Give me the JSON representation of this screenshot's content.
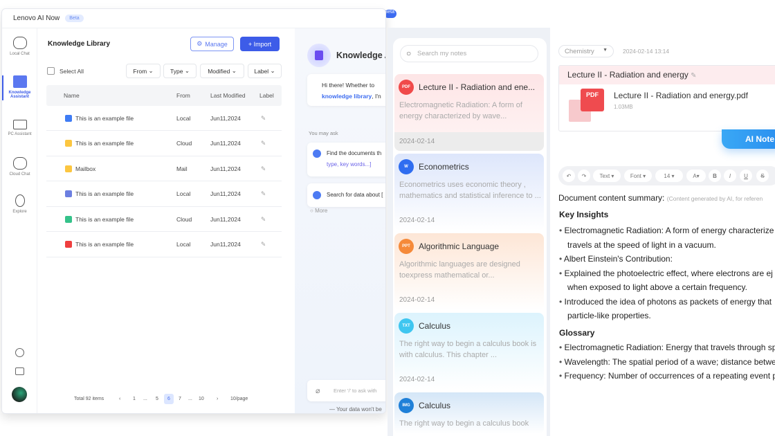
{
  "app": {
    "title": "Lenovo AI Now",
    "badge": "Beta"
  },
  "sidebar": {
    "items": [
      {
        "label": "Local Chat"
      },
      {
        "label": "Knowledge Assistant",
        "active": true
      },
      {
        "label": "PC Assistant"
      },
      {
        "label": "Cloud Chat"
      },
      {
        "label": "Explore"
      }
    ],
    "bottom_icons": [
      "clock-icon",
      "mail-icon",
      "avatar"
    ]
  },
  "library": {
    "title": "Knowledge Library",
    "manage": "Manage",
    "import": "+ Import",
    "select_all": "Select All",
    "filters": [
      "From",
      "Type",
      "Modified",
      "Label"
    ],
    "columns": [
      "Name",
      "From",
      "Last Modified",
      "Label"
    ],
    "rows": [
      {
        "name": "This is an example file",
        "from": "Local",
        "modified": "Jun11,2024",
        "type": "doc",
        "color": "#3f7cf4"
      },
      {
        "name": "This is an example file",
        "from": "Cloud",
        "modified": "Jun11,2024",
        "type": "folder",
        "color": "#fcc640"
      },
      {
        "name": "Mailbox",
        "from": "Mail",
        "modified": "Jun11,2024",
        "type": "mail-folder",
        "color": "#fcc640"
      },
      {
        "name": "This is an example file",
        "from": "Local",
        "modified": "Jun11,2024",
        "type": "doc",
        "color": "#6c7fe0"
      },
      {
        "name": "This is an example file",
        "from": "Cloud",
        "modified": "Jun11,2024",
        "type": "sheet",
        "color": "#35c28a"
      },
      {
        "name": "This is an example file",
        "from": "Local",
        "modified": "Jun11,2024",
        "type": "pdf",
        "color": "#ef3f3f"
      }
    ],
    "pager": {
      "total": "Total 92 items",
      "pages": [
        "1",
        "...",
        "5",
        "6",
        "7",
        "...",
        "10"
      ],
      "current": "6",
      "per_page": "10/page"
    }
  },
  "chat": {
    "title": "Knowledge A",
    "greeting_1": "Hi there! Whether to",
    "greeting_link": "knowledge library",
    "greeting_2": ", I'n",
    "you_may_ask": "You may ask",
    "q1": "Find the documents th",
    "q1_hint": "type, key words...]",
    "q2": "Search for data about [",
    "more": "More",
    "input_placeholder": "Enter '/' to ask with",
    "footer": "Your data won't be"
  },
  "notes": {
    "search_placeholder": "Search my notes",
    "items": [
      {
        "badge": "PDF",
        "color": "#f04a4a",
        "title": "Lecture II - Radiation and ene...",
        "preview": "Electromagnetic Radiation: A form of energy characterized by wave...",
        "date": "2024-02-14"
      },
      {
        "badge": "W",
        "color": "#2f6df0",
        "title": "Econometrics",
        "preview": "Econometrics uses economic theory , mathematics  and statistical inference to ...",
        "date": "2024-02-14"
      },
      {
        "badge": "PPT",
        "color": "#f58a3a",
        "title": "Algorithmic Language",
        "preview": "Algorithmic languages are designed toexpress mathematical or...",
        "date": "2024-02-14"
      },
      {
        "badge": "TXT",
        "color": "#3fc6f0",
        "title": "Calculus",
        "preview": "The right way to begin a calculus book is with calculus. This chapter ...",
        "date": "2024-02-14"
      },
      {
        "badge": "IMG",
        "color": "#1f80d8",
        "title": "Calculus",
        "preview": "The right way to begin a calculus book",
        "date": ""
      }
    ]
  },
  "detail": {
    "category": "Chemistry",
    "timestamp": "2024-02-14 13:14",
    "note_title": "Lecture II - Radiation and energy",
    "file_name": "Lecture II - Radiation and energy.pdf",
    "file_size": "1.03MB",
    "file_badge": "PDF",
    "ai_notes": "AI Note",
    "toolbar": [
      "Text",
      "Font",
      "14",
      "A",
      "B",
      "I",
      "U",
      "S"
    ],
    "summary_label": "Document content summary:",
    "summary_note": "(Content generated by AI, for referen",
    "key_insights": "Key Insights",
    "insights": [
      "Electromagnetic Radiation: A form of energy characterize",
      "travels at the speed of light in a vacuum.",
      "Albert Einstein's Contribution:",
      "Explained the photoelectric effect, where electrons are ej",
      "when exposed to light above a certain frequency.",
      "Introduced the idea of photons as packets of energy that",
      "particle-like properties."
    ],
    "glossary": "Glossary",
    "glossary_items": [
      "Electromagnetic Radiation: Energy that travels through sp",
      "Wavelength: The spatial period of a wave; distance betwe",
      "Frequency: Number of occurrences of a repeating event p"
    ]
  },
  "colors": {
    "accent": "#3d5ce8",
    "ai_button": "#2e9cf0"
  }
}
